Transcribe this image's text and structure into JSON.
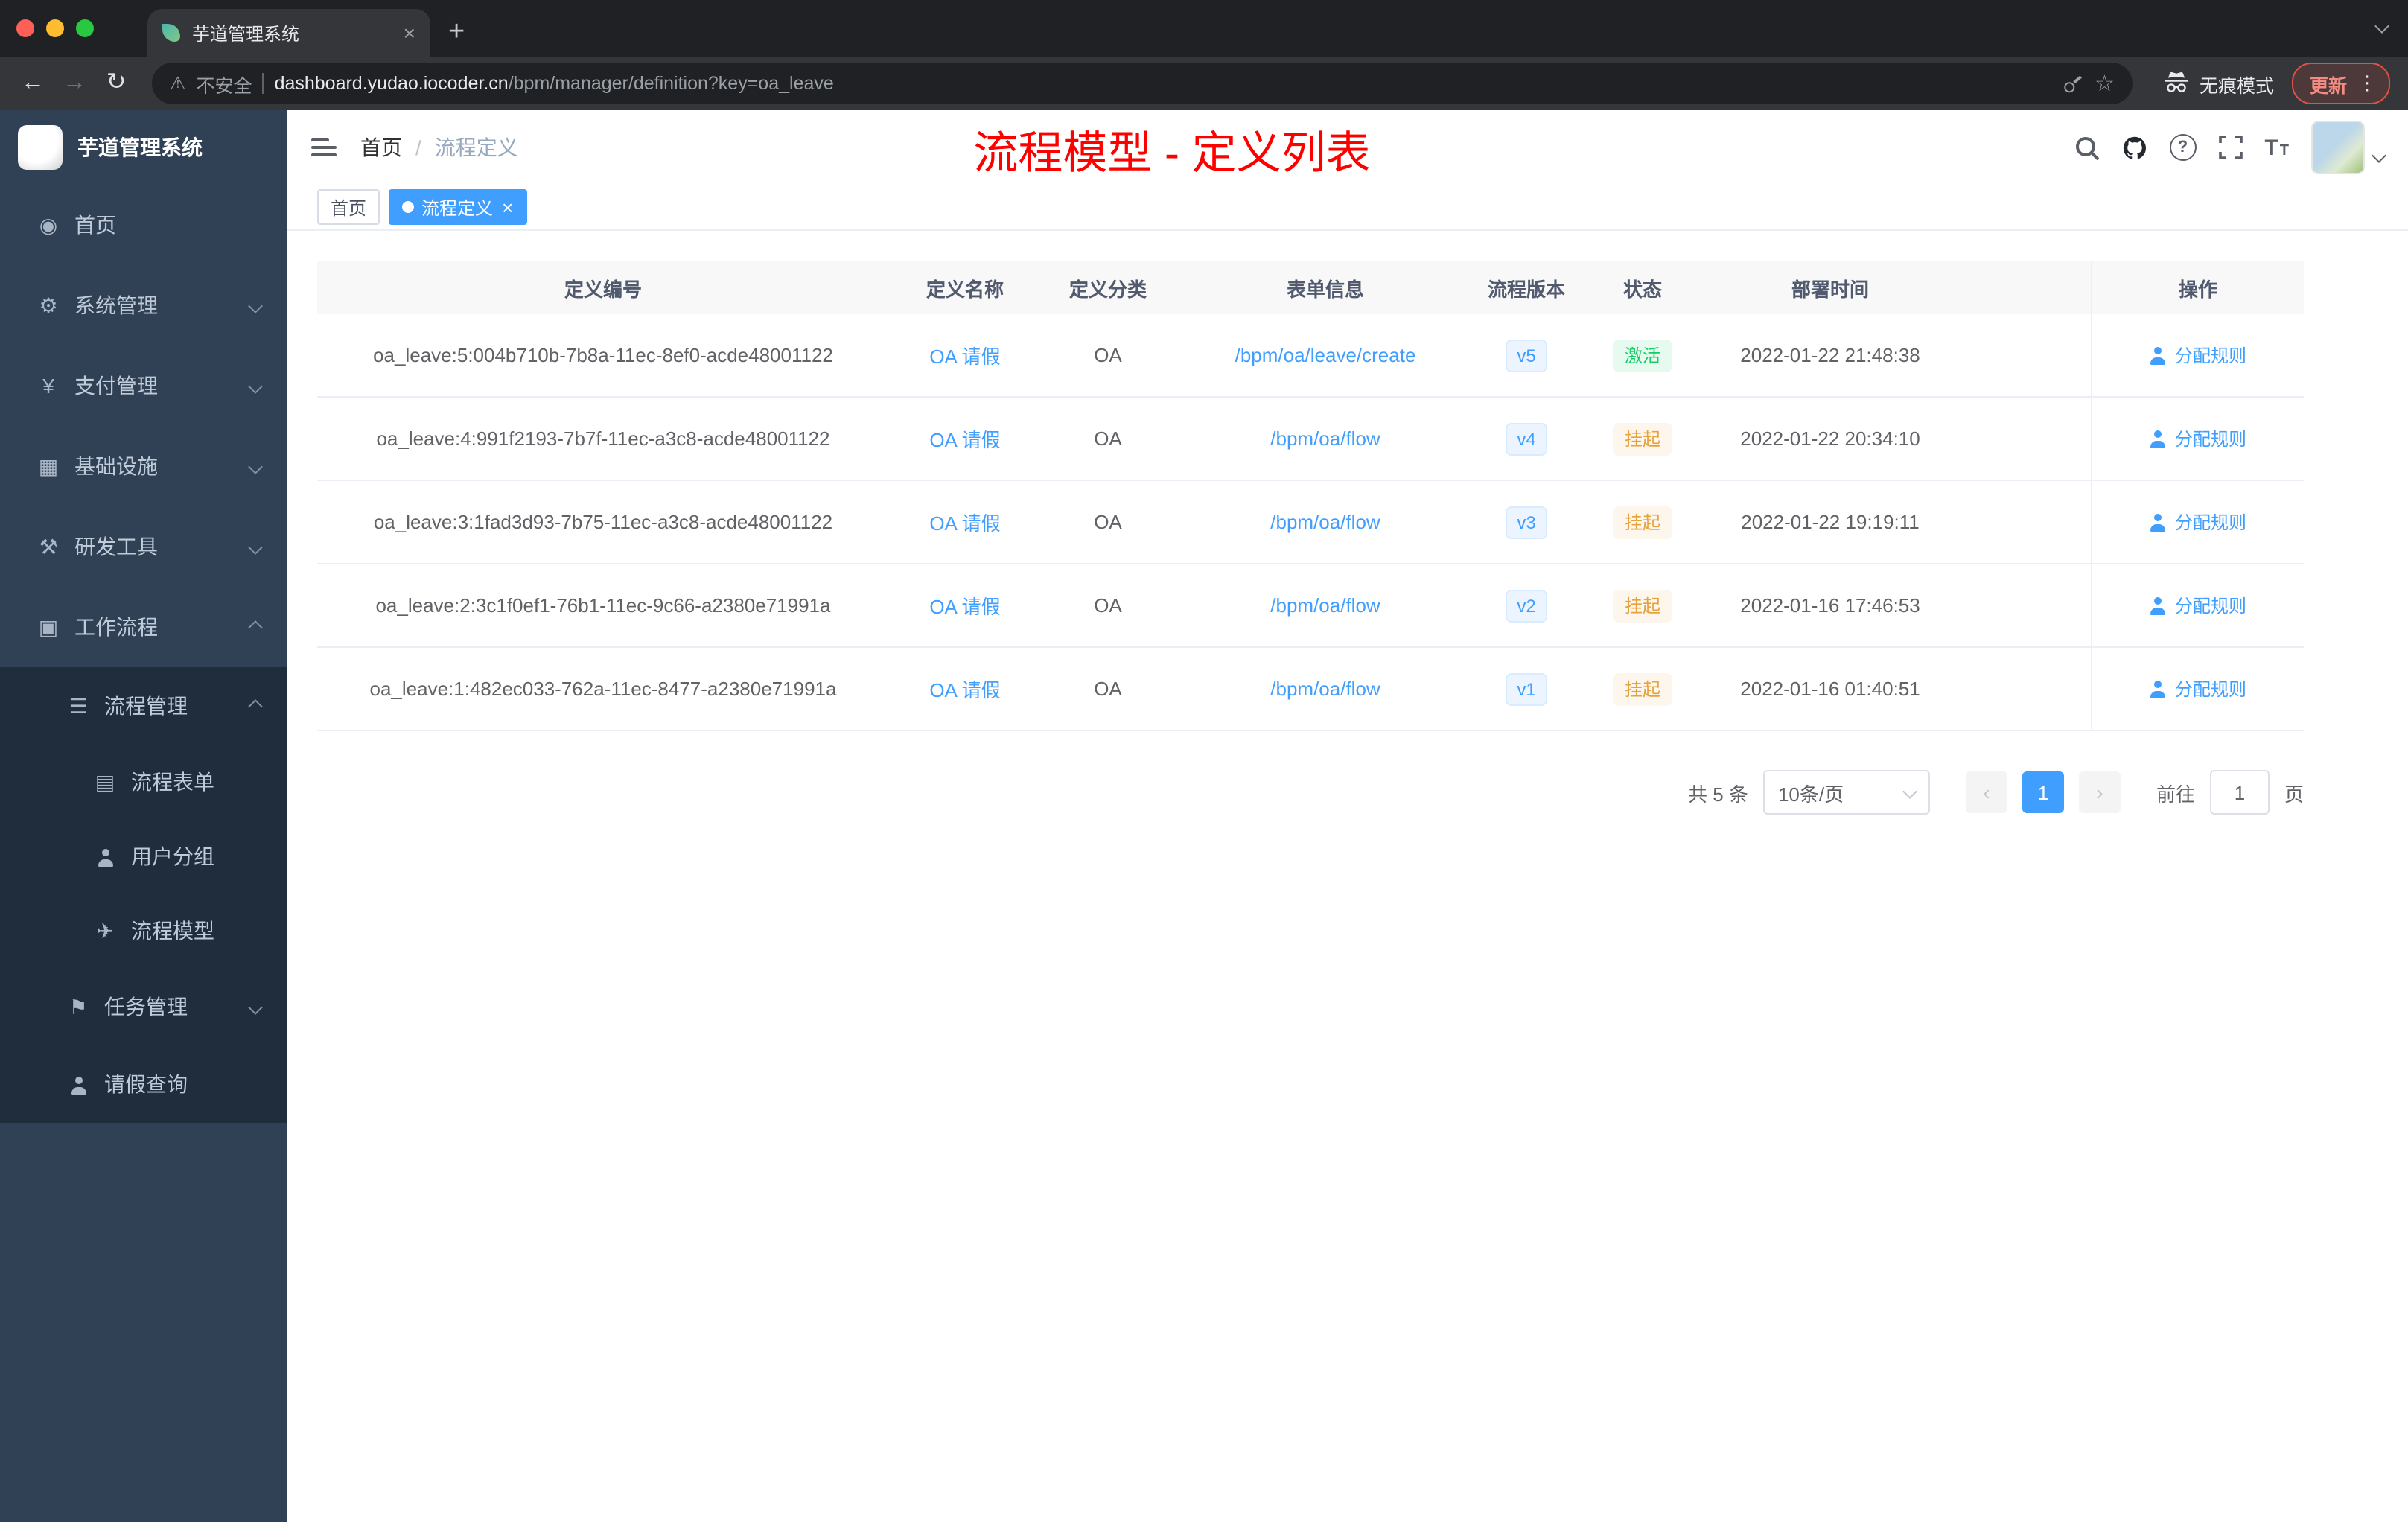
{
  "colors": {
    "accent": "#409eff",
    "title-red": "#ff0000",
    "sidebar-bg": "#304156",
    "submenu-bg": "#1f2d3d",
    "success-bg": "#e7faf0",
    "success-text": "#13ce66",
    "warning-bg": "#fdf6ec",
    "warning-text": "#e6a23c",
    "ver-bg": "#ecf5ff",
    "ver-border": "#d9ecff"
  },
  "icons": {
    "close": "×",
    "plus": "+",
    "back": "←",
    "forward": "→",
    "reload": "↻",
    "warning": "⚠",
    "star": "☆",
    "dots": "⋮",
    "slash": "/",
    "prev": "‹",
    "next": "›",
    "home": "◉",
    "gear": "⚙",
    "yen": "¥",
    "infra": "▦",
    "tools": "⚒",
    "workflow": "▣",
    "process_list": "☰",
    "form": "▤",
    "send": "✈",
    "task": "⚑"
  },
  "browser": {
    "tab_title": "芋道管理系统",
    "security_label": "不安全",
    "url_domain": "dashboard.yudao.iocoder.cn",
    "url_path": "/bpm/manager/definition?key=oa_leave",
    "incognito_label": "无痕模式",
    "update_label": "更新"
  },
  "sidebar": {
    "logo_title": "芋道管理系统",
    "items": [
      {
        "label": "首页",
        "icon": "dashboard-icon"
      },
      {
        "label": "系统管理",
        "icon": "gear-icon"
      },
      {
        "label": "支付管理",
        "icon": "yen-icon"
      },
      {
        "label": "基础设施",
        "icon": "infrastructure-icon"
      },
      {
        "label": "研发工具",
        "icon": "tools-icon"
      },
      {
        "label": "工作流程",
        "icon": "workflow-icon"
      },
      {
        "label": "流程管理",
        "icon": "process-list-icon"
      },
      {
        "label": "流程表单",
        "icon": "form-icon"
      },
      {
        "label": "用户分组",
        "icon": "user-group-icon"
      },
      {
        "label": "流程模型",
        "icon": "send-icon"
      },
      {
        "label": "任务管理",
        "icon": "task-icon"
      },
      {
        "label": "请假查询",
        "icon": "person-icon"
      }
    ]
  },
  "header": {
    "breadcrumb_root": "首页",
    "breadcrumb_current": "流程定义",
    "page_title": "流程模型 - 定义列表"
  },
  "tags": [
    {
      "label": "首页",
      "active": false
    },
    {
      "label": "流程定义",
      "active": true
    }
  ],
  "table": {
    "columns": [
      "定义编号",
      "定义名称",
      "定义分类",
      "表单信息",
      "流程版本",
      "状态",
      "部署时间",
      "操作"
    ],
    "rows": [
      {
        "id": "oa_leave:5:004b710b-7b8a-11ec-8ef0-acde48001122",
        "name": "OA 请假",
        "category": "OA",
        "form": "/bpm/oa/leave/create",
        "version": "v5",
        "status": "激活",
        "status_type": "success",
        "deploy_time": "2022-01-22 21:48:38",
        "action": "分配规则"
      },
      {
        "id": "oa_leave:4:991f2193-7b7f-11ec-a3c8-acde48001122",
        "name": "OA 请假",
        "category": "OA",
        "form": "/bpm/oa/flow",
        "version": "v4",
        "status": "挂起",
        "status_type": "warning",
        "deploy_time": "2022-01-22 20:34:10",
        "action": "分配规则"
      },
      {
        "id": "oa_leave:3:1fad3d93-7b75-11ec-a3c8-acde48001122",
        "name": "OA 请假",
        "category": "OA",
        "form": "/bpm/oa/flow",
        "version": "v3",
        "status": "挂起",
        "status_type": "warning",
        "deploy_time": "2022-01-22 19:19:11",
        "action": "分配规则"
      },
      {
        "id": "oa_leave:2:3c1f0ef1-76b1-11ec-9c66-a2380e71991a",
        "name": "OA 请假",
        "category": "OA",
        "form": "/bpm/oa/flow",
        "version": "v2",
        "status": "挂起",
        "status_type": "warning",
        "deploy_time": "2022-01-16 17:46:53",
        "action": "分配规则"
      },
      {
        "id": "oa_leave:1:482ec033-762a-11ec-8477-a2380e71991a",
        "name": "OA 请假",
        "category": "OA",
        "form": "/bpm/oa/flow",
        "version": "v1",
        "status": "挂起",
        "status_type": "warning",
        "deploy_time": "2022-01-16 01:40:51",
        "action": "分配规则"
      }
    ]
  },
  "pagination": {
    "total": "共 5 条",
    "page_size": "10条/页",
    "current_page": "1",
    "goto_label": "前往",
    "goto_value": "1",
    "page_unit": "页"
  }
}
